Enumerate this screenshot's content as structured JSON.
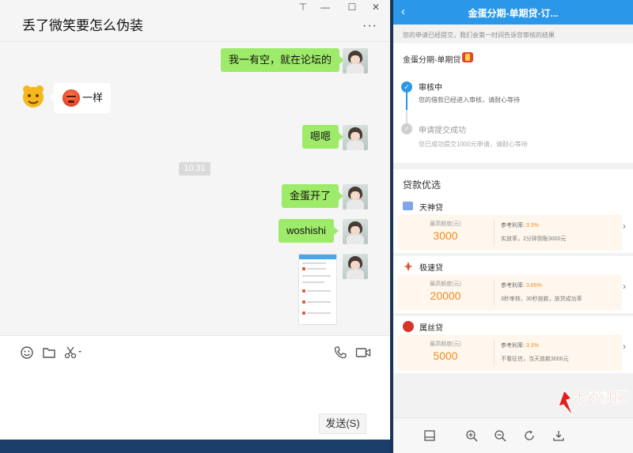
{
  "chat": {
    "title": "丢了微笑要怎么伪装",
    "window_controls": {
      "pin": "⊤",
      "minimize": "—",
      "maximize": "☐",
      "close": "✕"
    },
    "more": "···",
    "messages": {
      "m1": "我一有空，就在论坛的",
      "m2": "一样",
      "m3": "嗯嗯",
      "time": "10:31",
      "m4": "金蛋开了",
      "m5": "woshishi"
    },
    "send_label": "发送(S)"
  },
  "phone": {
    "title": "金蛋分期-单期贷-订...",
    "notice": "您的申请已经提交，我们会第一时间告诉您审核的结果",
    "product": "金蛋分期-单期贷",
    "steps": [
      {
        "title": "审核中",
        "desc": "您的借款已经进入审核，请耐心等待"
      },
      {
        "title": "申请提交成功",
        "desc": "您已成功提交1000元申请，请耐心等待"
      }
    ],
    "section_title": "贷款优选",
    "loans": [
      {
        "name": "天神贷",
        "quota_label": "最高额度(元)",
        "quota": "3000",
        "rate_label": "参考利率:",
        "rate": "3.3%",
        "desc": "实放率，2分钟到账3000元",
        "logo_color": "#7fa6e8"
      },
      {
        "name": "极速贷",
        "quota_label": "最高额度(元)",
        "quota": "20000",
        "rate_label": "参考利率:",
        "rate": "3.65%",
        "desc": "3秒审核，30秒放款，放贷成功率",
        "logo_color": "#e2532f"
      },
      {
        "name": "属丝贷",
        "quota_label": "最高额度(元)",
        "quota": "5000",
        "rate_label": "参考利率:",
        "rate": "3.3%",
        "desc": "不看征信，当天放款3000元",
        "logo_color": "#d9342a"
      }
    ]
  },
  "watermark": "卡农社区",
  "colors": {
    "wechat_green": "#9eea6a",
    "phone_blue": "#2b97e8",
    "amount_orange": "#f08a1c"
  }
}
